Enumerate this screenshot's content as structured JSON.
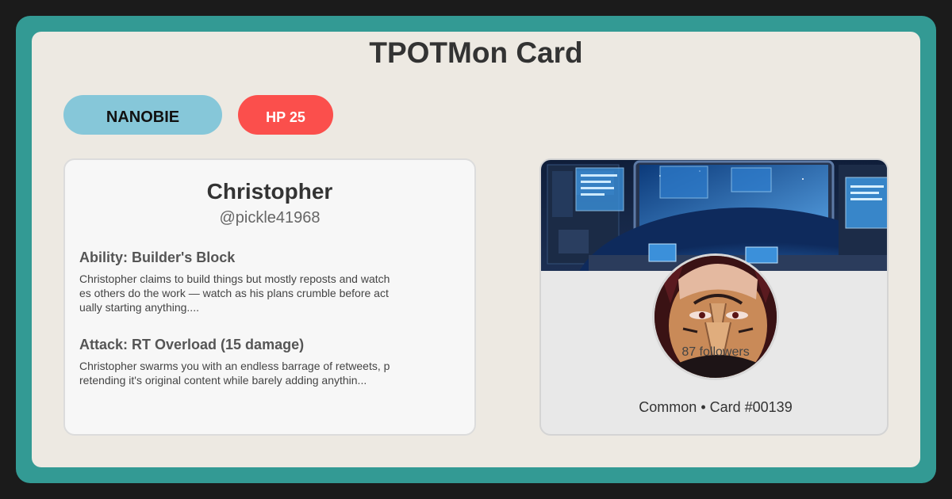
{
  "page": {
    "title": "TPOTMon Card"
  },
  "badges": {
    "type": "NANOBIE",
    "hp": "HP 25"
  },
  "profile": {
    "name": "Christopher",
    "handle": "@pickle41968",
    "followers": "87 followers"
  },
  "ability": {
    "title": "Ability: Builder's Block",
    "text": "Christopher claims to build things but mostly reposts and watches others do the work — watch as his plans crumble before actually starting anything...."
  },
  "attack": {
    "title": "Attack: RT Overload (15 damage)",
    "text": "Christopher swarms you with an endless barrage of retweets, pretending it's original content while barely adding anythin..."
  },
  "footer": {
    "rarity_line": "Common • Card #00139"
  },
  "colors": {
    "frame": "#339a94",
    "card_bg": "#ede9e2",
    "type_pill": "#86c7d9",
    "hp_pill": "#fb4f4c"
  },
  "images": {
    "banner": "space-station-window-banner",
    "avatar": "anime-character-avatar"
  }
}
